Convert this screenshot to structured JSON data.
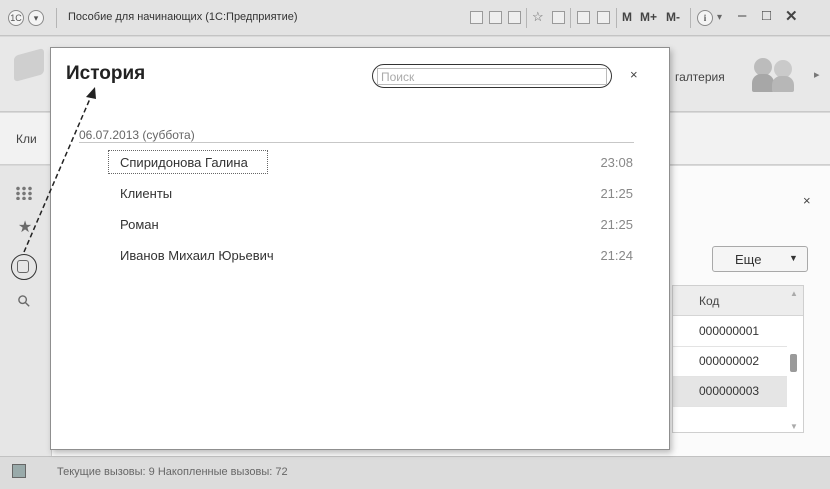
{
  "window": {
    "title": "Пособие для начинающих  (1С:Предприятие)",
    "m_labels": [
      "M",
      "M+",
      "M-"
    ]
  },
  "background": {
    "section_label": "галтерия",
    "tab_label": "Кли",
    "more_button": "Еще",
    "table": {
      "header": "Код",
      "rows": [
        "000000001",
        "000000002",
        "000000003"
      ]
    }
  },
  "history": {
    "title": "История",
    "search_placeholder": "Поиск",
    "date_header": "06.07.2013 (суббота)",
    "items": [
      {
        "name": "Спиридонова Галина",
        "time": "23:08"
      },
      {
        "name": "Клиенты",
        "time": "21:25"
      },
      {
        "name": "Роман",
        "time": "21:25"
      },
      {
        "name": "Иванов Михаил Юрьевич",
        "time": "21:24"
      }
    ]
  },
  "status": {
    "text": "Текущие вызовы: 9  Накопленные вызовы: 72"
  },
  "icons": {
    "close": "×",
    "star": "★",
    "search": "⚲",
    "dropdown": "▼",
    "chevron": "▸"
  }
}
